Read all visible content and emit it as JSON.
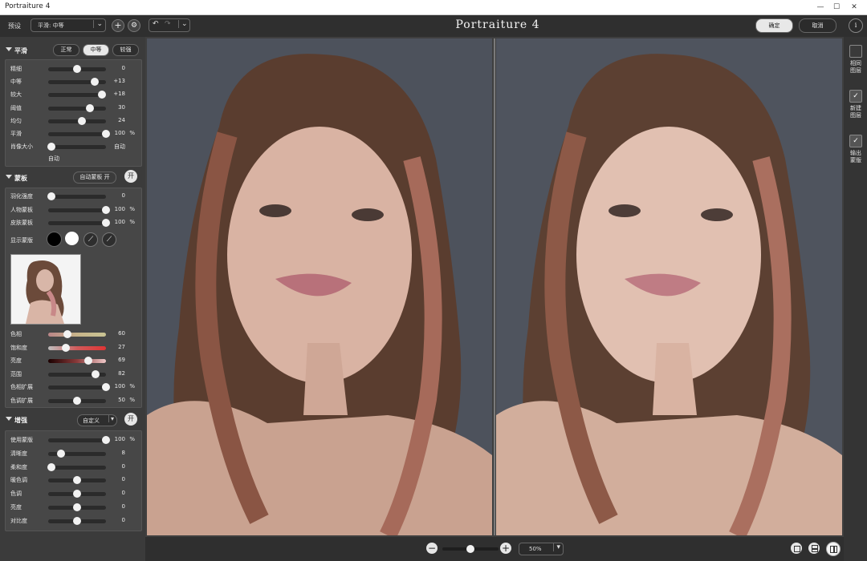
{
  "window": {
    "title": "Portraiture 4"
  },
  "toolbar": {
    "preset_label": "预设",
    "preset_value": "平滑: 中等",
    "app_title": "Portraiture 4",
    "ok_label": "确定",
    "cancel_label": "取消"
  },
  "smooth": {
    "header": "平滑",
    "modes": [
      "正常",
      "中等",
      "较强"
    ],
    "active_mode": "中等",
    "sliders": [
      {
        "label": "精细",
        "value": "0",
        "pct": "",
        "level": 0.5
      },
      {
        "label": "中等",
        "value": "+13",
        "pct": "",
        "level": 0.8
      },
      {
        "label": "较大",
        "value": "+18",
        "pct": "",
        "level": 0.93
      },
      {
        "label": "阈值",
        "value": "30",
        "pct": "",
        "level": 0.72
      },
      {
        "label": "均匀",
        "value": "24",
        "pct": "",
        "level": 0.58
      },
      {
        "label": "平滑",
        "value": "100",
        "pct": "%",
        "level": 1.0
      },
      {
        "label": "肖像大小",
        "value": "自动",
        "pct": "",
        "level": 0.05
      }
    ],
    "portrait_size_sub": "自动"
  },
  "mask": {
    "header": "蒙板",
    "auto_mask_label": "自动蒙板 开",
    "toggle_label": "开",
    "sliders": [
      {
        "label": "羽化强度",
        "value": "0",
        "pct": "",
        "level": 0.05
      },
      {
        "label": "人物蒙板",
        "value": "100",
        "pct": "%",
        "level": 1.0
      },
      {
        "label": "皮肤蒙板",
        "value": "100",
        "pct": "%",
        "level": 1.0
      }
    ],
    "show_mask_label": "显示蒙版",
    "color_sliders": [
      {
        "label": "色相",
        "value": "60",
        "pct": "",
        "level": 0.33,
        "gradient": "linear-gradient(90deg,#b98588,#c8b48a,#c9c493)"
      },
      {
        "label": "饱和度",
        "value": "27",
        "pct": "",
        "level": 0.3,
        "gradient": "linear-gradient(90deg,#bfbfbf,#d05a5a,#e03434)"
      },
      {
        "label": "亮度",
        "value": "69",
        "pct": "",
        "level": 0.7,
        "gradient": "linear-gradient(90deg,#1a0000,#8a3a3a,#f0c8c8)"
      },
      {
        "label": "范围",
        "value": "82",
        "pct": "",
        "level": 0.82,
        "gradient": ""
      },
      {
        "label": "色相扩展",
        "value": "100",
        "pct": "%",
        "level": 1.0,
        "gradient": ""
      },
      {
        "label": "色调扩展",
        "value": "50",
        "pct": "%",
        "level": 0.5,
        "gradient": ""
      }
    ]
  },
  "enhance": {
    "header": "增强",
    "preset_value": "自定义",
    "toggle_label": "开",
    "sliders": [
      {
        "label": "使用蒙版",
        "value": "100",
        "pct": "%",
        "level": 1.0
      },
      {
        "label": "清晰度",
        "value": "8",
        "pct": "",
        "level": 0.22
      },
      {
        "label": "柔和度",
        "value": "0",
        "pct": "",
        "level": 0.05
      },
      {
        "label": "暖色调",
        "value": "0",
        "pct": "",
        "level": 0.5
      },
      {
        "label": "色调",
        "value": "0",
        "pct": "",
        "level": 0.5
      },
      {
        "label": "亮度",
        "value": "0",
        "pct": "",
        "level": 0.5
      },
      {
        "label": "对比度",
        "value": "0",
        "pct": "",
        "level": 0.5
      }
    ]
  },
  "right_options": [
    {
      "label": "相同\n图层",
      "checked": false
    },
    {
      "label": "新建\n图层",
      "checked": true
    },
    {
      "label": "输出\n蒙版",
      "checked": true
    }
  ],
  "bottom": {
    "zoom_level": 0.5,
    "zoom_value": "50%"
  },
  "colors": {
    "panel_bg": "#3b3b3b",
    "section_bg": "#474747",
    "accent_white": "#f2f2f2"
  }
}
